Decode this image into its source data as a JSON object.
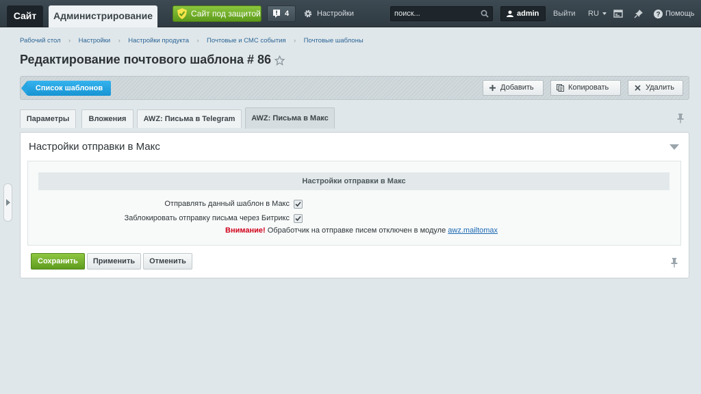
{
  "topbar": {
    "site_tab": "Сайт",
    "admin_tab": "Администрирование",
    "protected_label": "Сайт под защитой",
    "notifications_count": "4",
    "settings_label": "Настройки",
    "search_placeholder": "поиск...",
    "user_label": "admin",
    "logout_label": "Выйти",
    "lang_label": "RU",
    "help_label": "Помощь"
  },
  "breadcrumb": [
    "Рабочий стол",
    "Настройки",
    "Настройки продукта",
    "Почтовые и СМС события",
    "Почтовые шаблоны"
  ],
  "page": {
    "title": "Редактирование почтового шаблона # 86"
  },
  "toolbar": {
    "list_label": "Список шаблонов",
    "add_label": "Добавить",
    "copy_label": "Копировать",
    "delete_label": "Удалить"
  },
  "tabs": [
    {
      "label": "Параметры"
    },
    {
      "label": "Вложения"
    },
    {
      "label": "AWZ: Письма в Telegram"
    },
    {
      "label": "AWZ: Письма в Макс",
      "active": true
    }
  ],
  "panel": {
    "title": "Настройки отправки в Макс",
    "section_title": "Настройки отправки в Макс",
    "fields": [
      {
        "label": "Отправлять данный шаблон в Макс",
        "checked": true
      },
      {
        "label": "Заблокировать отправку письма через Битрикс",
        "checked": true
      }
    ],
    "warning_strong": "Внимание!",
    "warning_text": "Обработчик на отправке писем отключен в модуле",
    "warning_link": "awz.mailtomax"
  },
  "actions": {
    "save_label": "Сохранить",
    "apply_label": "Применить",
    "cancel_label": "Отменить"
  },
  "colors": {
    "accent_blue": "#1794d3",
    "accent_green": "#5f9c1e",
    "warning_red": "#d0021b"
  }
}
